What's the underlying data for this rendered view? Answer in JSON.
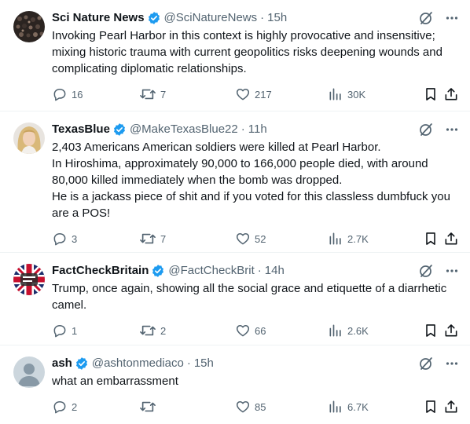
{
  "posts": [
    {
      "name": "Sci Nature News",
      "handle": "@SciNatureNews",
      "sep": "·",
      "time": "15h",
      "lines": [
        "Invoking Pearl Harbor in this context is highly provocative and insensitive; mixing historic trauma with current geopolitics risks deepening wounds and complicating diplomatic relationships."
      ],
      "replies": "16",
      "reposts": "7",
      "likes": "217",
      "views": "30K",
      "avatar": "dark-crowd-avatar"
    },
    {
      "name": "TexasBlue",
      "handle": "@MakeTexasBlue22",
      "sep": "·",
      "time": "11h",
      "lines": [
        "2,403 Americans American soldiers were killed at Pearl Harbor.",
        "In Hiroshima, approximately 90,000 to 166,000 people died, with around 80,000 killed immediately when the bomb was dropped.",
        "He is a jackass piece of shit and if you voted for this classless dumbfuck you are a POS!"
      ],
      "replies": "3",
      "reposts": "7",
      "likes": "52",
      "views": "2.7K",
      "avatar": "blonde-woman-avatar"
    },
    {
      "name": "FactCheckBritain",
      "handle": "@FactCheckBrit",
      "sep": "·",
      "time": "14h",
      "lines": [
        "Trump, once again, showing all the social grace and etiquette of a diarrhetic camel."
      ],
      "replies": "1",
      "reposts": "2",
      "likes": "66",
      "views": "2.6K",
      "avatar": "union-jack-avatar"
    },
    {
      "name": "ash",
      "handle": "@ashtonmediaco",
      "sep": "·",
      "time": "15h",
      "lines": [
        "what an embarrassment"
      ],
      "replies": "2",
      "reposts": "",
      "likes": "85",
      "views": "6.7K",
      "avatar": "default-avatar"
    }
  ],
  "colors": {
    "text": "#0f1419",
    "muted": "#536471",
    "verified": "#1d9bf0",
    "border": "#eff3f4"
  }
}
